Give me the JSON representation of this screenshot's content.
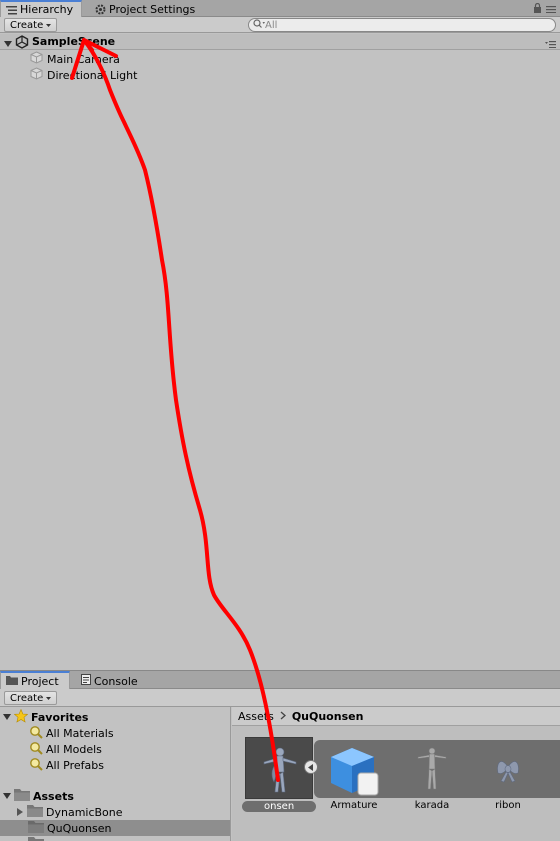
{
  "hierarchy_panel": {
    "tabs": [
      {
        "label": "Hierarchy",
        "icon": "list-icon"
      },
      {
        "label": "Project Settings",
        "icon": "gear-icon"
      }
    ],
    "create_label": "Create",
    "search_placeholder": "All",
    "scene_name": "SampleScene",
    "objects": [
      "Main Camera",
      "Directional Light"
    ]
  },
  "project_panel": {
    "tabs": [
      {
        "label": "Project",
        "icon": "folder-icon"
      },
      {
        "label": "Console",
        "icon": "console-icon"
      }
    ],
    "create_label": "Create",
    "favorites": {
      "label": "Favorites",
      "items": [
        "All Materials",
        "All Models",
        "All Prefabs"
      ]
    },
    "assets": {
      "label": "Assets",
      "folders": [
        "DynamicBone",
        "QuQuonsen"
      ],
      "selected_folder": "QuQuonsen"
    },
    "breadcrumb": [
      "Assets",
      "QuQuonsen"
    ],
    "grid_items": [
      {
        "label": "onsen",
        "icon": "model-prefab-icon",
        "selected": true
      },
      {
        "label": "Armature",
        "icon": "cube-icon"
      },
      {
        "label": "karada",
        "icon": "mesh-figure-icon"
      },
      {
        "label": "ribon",
        "icon": "mesh-ribbon-icon"
      }
    ]
  },
  "colors": {
    "panel_bg": "#c2c2c2",
    "tab_accent": "#4a7fd4",
    "annotation_arrow": "#ff0000",
    "selection": "#8e8e8e"
  }
}
